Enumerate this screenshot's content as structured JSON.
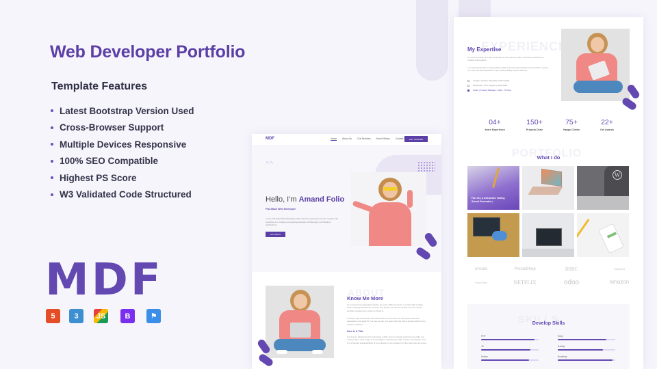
{
  "headline": "Web Developer Portfolio",
  "features": {
    "heading": "Template Features",
    "items": [
      "Latest Bootstrap Version Used",
      "Cross-Browser Support",
      "Multiple Devices Responsive",
      "100% SEO Compatible",
      "Highest PS Score",
      "W3 Validated Code Structured"
    ]
  },
  "brand": {
    "logo": "MDF",
    "accent": "#6248b0"
  },
  "tech_icons": [
    {
      "name": "html5-icon",
      "glyph": "5",
      "color": "#e44d26"
    },
    {
      "name": "css3-icon",
      "glyph": "3",
      "color": "#3d8fd1"
    },
    {
      "name": "js-icon",
      "glyph": "JS",
      "color": "#f0b400"
    },
    {
      "name": "bootstrap-icon",
      "glyph": "B",
      "color": "#7a2ff0"
    },
    {
      "name": "flag-icon",
      "glyph": "⚑",
      "color": "#3b8ee8"
    }
  ],
  "home_mockup": {
    "logo": "MDF",
    "nav": [
      "Home",
      "About Us",
      "Our Services",
      "How It Works",
      "Contact Us"
    ],
    "cta": "GET STARTED",
    "hero_greeting": "Hello, I'm ",
    "hero_name": "Amand Folio",
    "hero_role": "Full-Stack Web Developer",
    "hero_text": "I am a Full-Stack Web Developer with extensive experience of over 4 years. My expertise is in creating & designing websites, Mobile Apps, and Desktop Applications.",
    "hero_button": "SAY HELLO",
    "about_ghost": "ABOUT",
    "about_heading": "Know Me More",
    "about_p1": "I've created and upgraded websites for many different clients. I worked with multiple CMS including WordPress, Joomla, and Drupal, as well as created my own custom website management system in Node.js.",
    "about_p2": "I've been part of the team that has built the front-end for an enterprise level web application in AngularJS. I've been a part of a team that has built a social network from scratch in Meteor.",
    "about_heading2": "Here Is A Title",
    "about_p3": "I've diverse background in technology, which more I'm always learning new skills. I've worked with a wide range of technologies, including Git, SQL, Docker and Python. One of my favorite characteristics of an employer is their passion for the work they are doing."
  },
  "detail_mockup": {
    "expertise_ghost": "EXPERIENCE",
    "expertise_heading": "My Expertise",
    "expertise_p1": "I've been working as a web developer for the past two years, and have experience in multiple Frameworks.",
    "expertise_p2": "I am passionate about creating high quality products and beautiful user interfaces, giving my users the best experience they could possibly expect fast time.",
    "jobs": [
      {
        "text": "Google | System Specialist | 2017-2018",
        "active": false
      },
      {
        "text": "Facebook | Tech Support | 2018-2020",
        "active": false
      },
      {
        "text": "Netflix | Product Manager | 2020 - Till Now",
        "active": true
      }
    ],
    "stats": [
      {
        "value": "04+",
        "label": "Years Experience"
      },
      {
        "value": "150+",
        "label": "Projects Done"
      },
      {
        "value": "75+",
        "label": "Happy Clients"
      },
      {
        "value": "22+",
        "label": "Get Awards"
      }
    ],
    "portfolio_ghost": "PORTFOLIO",
    "portfolio_heading": "What I do",
    "portfolio_caption": "Fart JS ( A Interactive Farting Sound Generator )",
    "clients": [
      "envato",
      "PrestaShop",
      "HSBC",
      "indiamart",
      "StoreView",
      "NETFLIX",
      "odoo",
      "amazon"
    ],
    "skills_ghost": "SKILLS",
    "skills_heading": "Develop Skills",
    "skills": [
      {
        "name": "PHP",
        "percent": 93
      },
      {
        "name": "Ruby",
        "percent": 85
      },
      {
        "name": "JS",
        "percent": 86
      },
      {
        "name": "Solidity",
        "percent": 79
      },
      {
        "name": "Python",
        "percent": 83
      },
      {
        "name": "Bootstrap",
        "percent": 95
      }
    ]
  }
}
